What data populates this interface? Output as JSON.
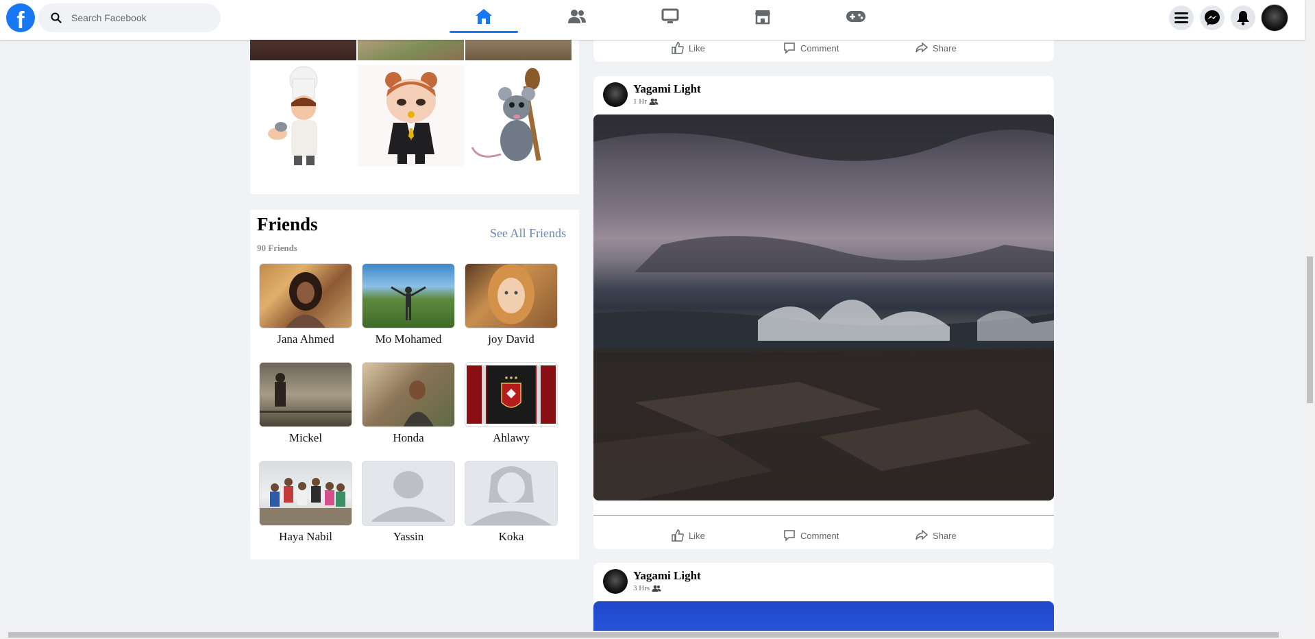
{
  "search": {
    "placeholder": "Search Facebook"
  },
  "logo": {
    "letter": "f"
  },
  "nav": {
    "tabs": [
      {
        "name": "Home",
        "icon": "home-icon",
        "active": true
      },
      {
        "name": "Friends",
        "icon": "friends-icon",
        "active": false
      },
      {
        "name": "Watch",
        "icon": "watch-icon",
        "active": false
      },
      {
        "name": "Marketplace",
        "icon": "marketplace-icon",
        "active": false
      },
      {
        "name": "Gaming",
        "icon": "gaming-icon",
        "active": false
      }
    ],
    "right_buttons": [
      "menu-icon",
      "messenger-icon",
      "notifications-icon"
    ]
  },
  "friends": {
    "title": "Friends",
    "count_label": "90 Friends",
    "see_all_label": "See All Friends",
    "list": [
      {
        "name": "Jana Ahmed"
      },
      {
        "name": "Mo Mohamed"
      },
      {
        "name": "joy David"
      },
      {
        "name": "Mickel"
      },
      {
        "name": "Honda"
      },
      {
        "name": "Ahlawy"
      },
      {
        "name": "Haya Nabil"
      },
      {
        "name": "Yassin"
      },
      {
        "name": "Koka"
      }
    ]
  },
  "actions": {
    "like": "Like",
    "comment": "Comment",
    "share": "Share"
  },
  "posts": [
    {
      "author": "Yagami Light",
      "time": "1 Hr"
    },
    {
      "author": "Yagami Light",
      "time": "3 Hrs"
    }
  ],
  "colors": {
    "brand": "#1877f2",
    "link": "#6b86b8",
    "background": "#f0f2f5"
  }
}
